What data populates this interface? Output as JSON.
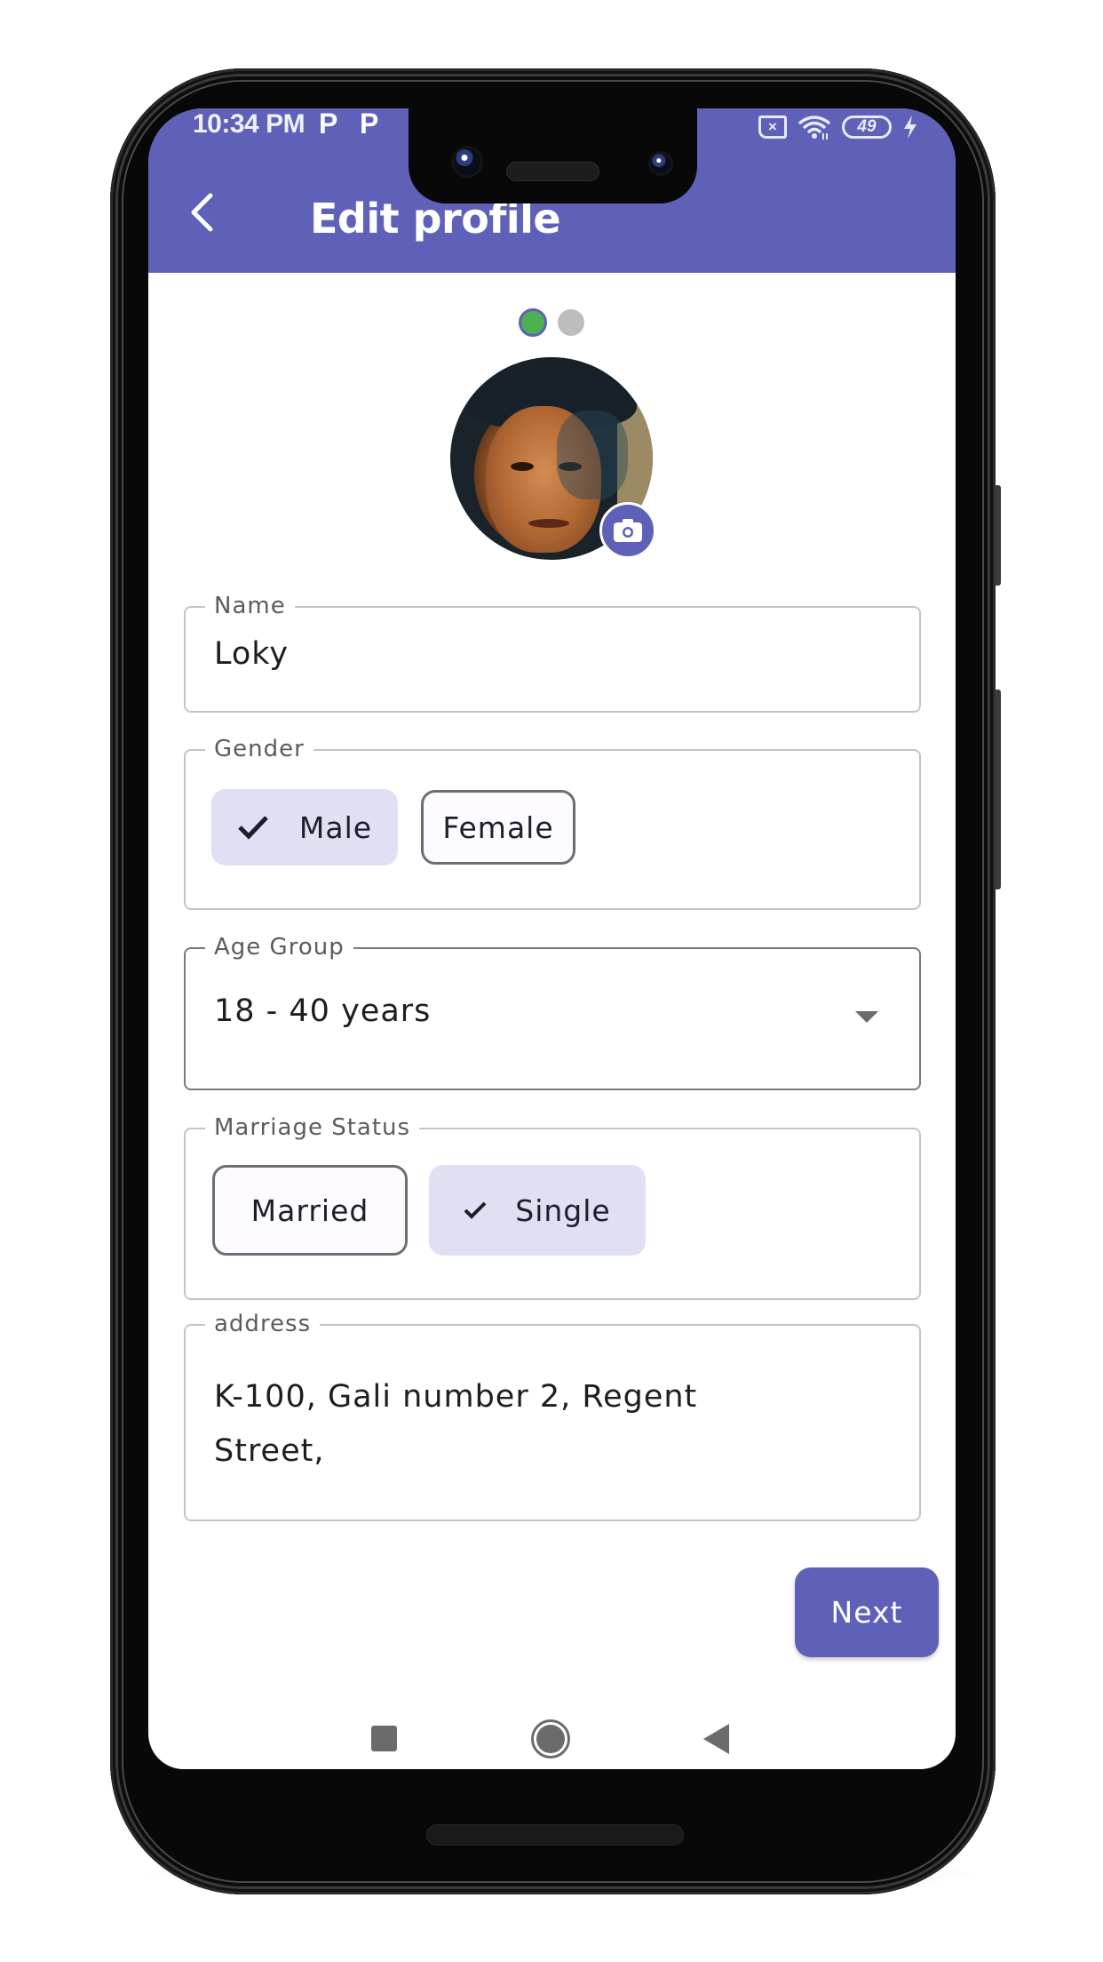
{
  "status_bar": {
    "time": "10:34 PM",
    "notification_icons": [
      "P",
      "P"
    ],
    "battery_level": "49",
    "icons": [
      "no-sim-icon",
      "wifi-icon",
      "battery-icon",
      "charging-bolt-icon"
    ]
  },
  "app_bar": {
    "title": "Edit profile",
    "back_icon": "chevron-left-icon",
    "color": "#5f60b8"
  },
  "stepper": {
    "current_step": 1,
    "total_steps": 2,
    "active_color": "#4caf50",
    "inactive_color": "#bdbdbd"
  },
  "avatar": {
    "edit_icon": "camera-icon"
  },
  "form": {
    "name": {
      "label": "Name",
      "value": "Loky"
    },
    "gender": {
      "label": "Gender",
      "options": [
        {
          "label": "Male",
          "selected": true
        },
        {
          "label": "Female",
          "selected": false
        }
      ]
    },
    "age_group": {
      "label": "Age Group",
      "value": "18 - 40 years"
    },
    "marriage_status": {
      "label": "Marriage Status",
      "options": [
        {
          "label": "Married",
          "selected": false
        },
        {
          "label": "Single",
          "selected": true
        }
      ]
    },
    "address": {
      "label": "address",
      "value": "K-100, Gali number 2, Regent Street,"
    }
  },
  "actions": {
    "next_label": "Next"
  },
  "system_nav": {
    "buttons": [
      "recents",
      "home",
      "back"
    ]
  }
}
